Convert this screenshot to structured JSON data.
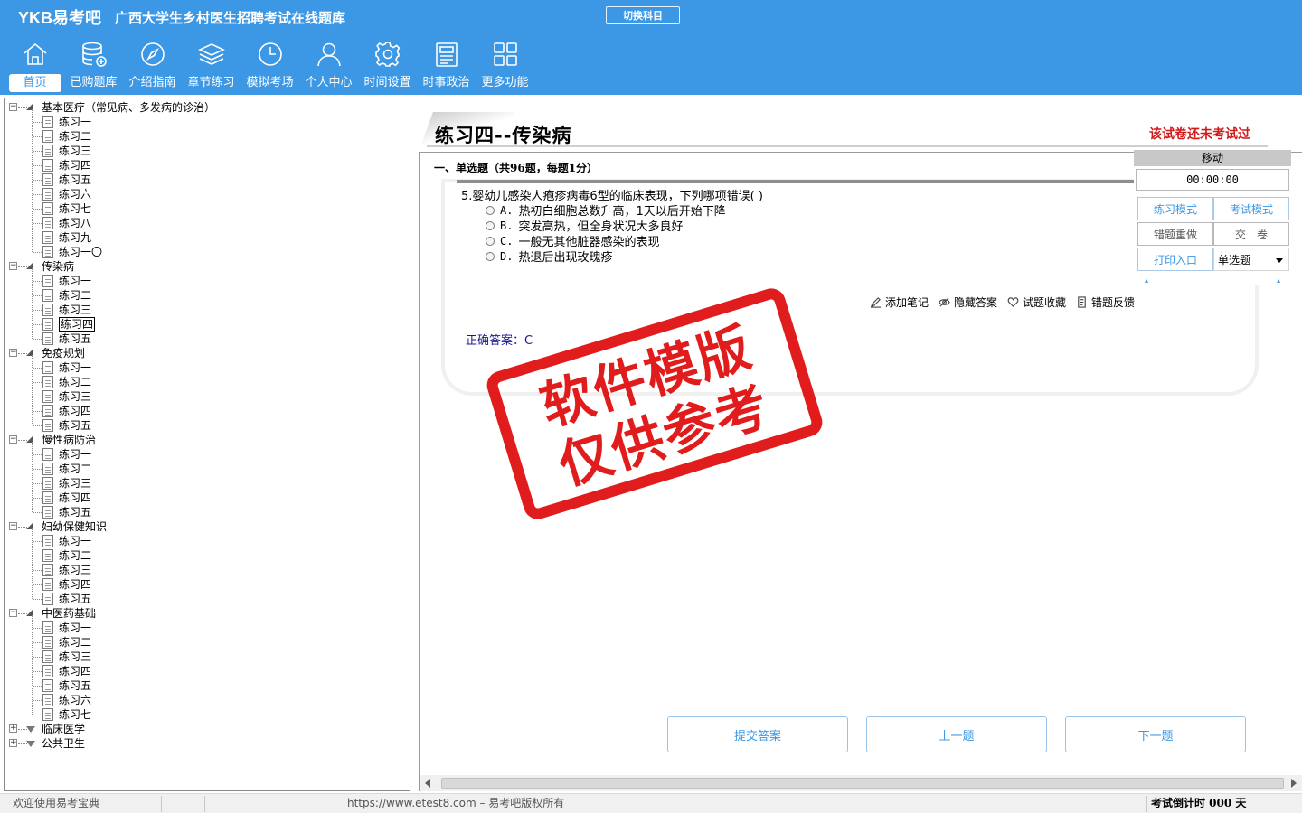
{
  "app": {
    "logo": "YKB易考吧",
    "title": "广西大学生乡村医生招聘考试在线题库",
    "switch_label": "切换科目"
  },
  "nav": [
    {
      "label": "首页",
      "icon": "home-icon"
    },
    {
      "label": "已购题库",
      "icon": "database-icon"
    },
    {
      "label": "介绍指南",
      "icon": "compass-icon"
    },
    {
      "label": "章节练习",
      "icon": "layers-icon"
    },
    {
      "label": "模拟考场",
      "icon": "clock-icon"
    },
    {
      "label": "个人中心",
      "icon": "user-icon"
    },
    {
      "label": "时间设置",
      "icon": "gear-icon"
    },
    {
      "label": "时事政治",
      "icon": "news-icon"
    },
    {
      "label": "更多功能",
      "icon": "grid-icon"
    }
  ],
  "tree": [
    {
      "label": "基本医疗（常见病、多发病的诊治）",
      "expanded": true,
      "children": [
        "练习一",
        "练习二",
        "练习三",
        "练习四",
        "练习五",
        "练习六",
        "练习七",
        "练习八",
        "练习九",
        "练习一〇"
      ]
    },
    {
      "label": "传染病",
      "expanded": true,
      "children": [
        "练习一",
        "练习二",
        "练习三",
        "练习四",
        "练习五"
      ],
      "selected": 3
    },
    {
      "label": "免疫规划",
      "expanded": true,
      "children": [
        "练习一",
        "练习二",
        "练习三",
        "练习四",
        "练习五"
      ]
    },
    {
      "label": "慢性病防治",
      "expanded": true,
      "children": [
        "练习一",
        "练习二",
        "练习三",
        "练习四",
        "练习五"
      ]
    },
    {
      "label": "妇幼保健知识",
      "expanded": true,
      "children": [
        "练习一",
        "练习二",
        "练习三",
        "练习四",
        "练习五"
      ]
    },
    {
      "label": "中医药基础",
      "expanded": true,
      "children": [
        "练习一",
        "练习二",
        "练习三",
        "练习四",
        "练习五",
        "练习六",
        "练习七"
      ]
    },
    {
      "label": "临床医学",
      "expanded": false,
      "children": []
    },
    {
      "label": "公共卫生",
      "expanded": false,
      "children": []
    }
  ],
  "paper": {
    "title": "练习四--传染病",
    "status": "该试卷还未考试过",
    "section": "一、单选题（共96题，每题1分）"
  },
  "question": {
    "stem": "5.婴幼儿感染人疱疹病毒6型的临床表现，下列哪项错误( )",
    "options": [
      {
        "key": "A.",
        "text": "热初白细胞总数升高，1天以后开始下降"
      },
      {
        "key": "B.",
        "text": "突发高热，但全身状况大多良好"
      },
      {
        "key": "C.",
        "text": "一般无其他脏器感染的表现"
      },
      {
        "key": "D.",
        "text": "热退后出现玫瑰疹"
      }
    ],
    "answer_label": "正确答案：",
    "answer_value": "C"
  },
  "tools": [
    {
      "label": "添加笔记",
      "icon": "pencil-icon"
    },
    {
      "label": "隐藏答案",
      "icon": "eye-icon"
    },
    {
      "label": "试题收藏",
      "icon": "heart-icon"
    },
    {
      "label": "错题反馈",
      "icon": "feedback-icon"
    }
  ],
  "control": {
    "move_label": "移动",
    "timer": "00:00:00",
    "practice_mode": "练习模式",
    "exam_mode": "考试模式",
    "redo_wrong": "错题重做",
    "submit_paper": "交　卷",
    "print": "打印入口",
    "type_select": "单选题"
  },
  "stamp": {
    "line1": "软件模版",
    "line2": "仅供参考"
  },
  "buttons": {
    "submit": "提交答案",
    "prev": "上一题",
    "next": "下一题"
  },
  "statusbar": {
    "welcome": "欢迎使用易考宝典",
    "copyright": "https://www.etest8.com – 易考吧版权所有",
    "countdown": "考试倒计时 000 天"
  },
  "colors": {
    "header_bg": "#3c97e4",
    "status_red": "#d21818",
    "stamp_red": "#e01010"
  }
}
